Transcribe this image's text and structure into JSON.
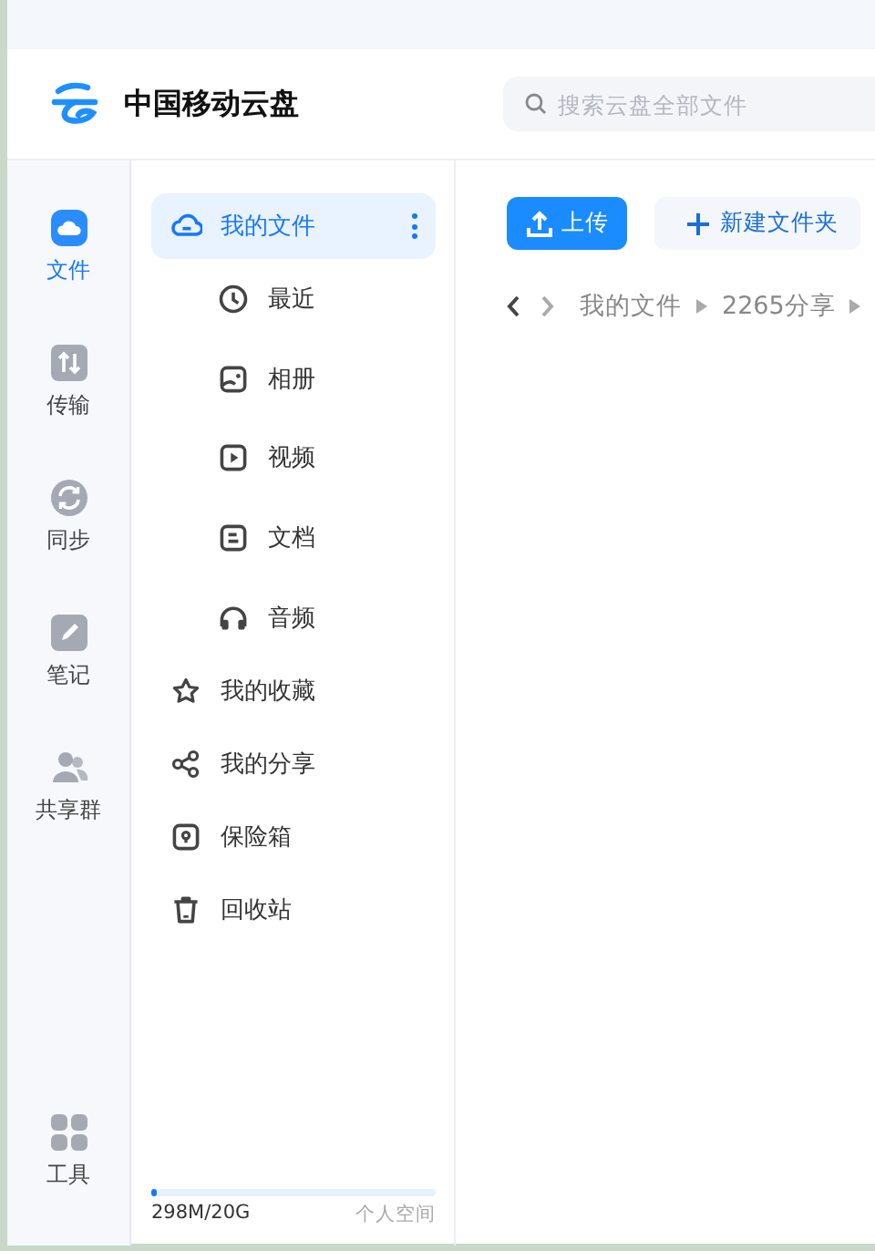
{
  "app": {
    "title": "中国移动云盘"
  },
  "search": {
    "placeholder": "搜索云盘全部文件"
  },
  "rail": [
    {
      "kind": "files",
      "label": "文件",
      "selected": true
    },
    {
      "kind": "transfer",
      "label": "传输",
      "selected": false
    },
    {
      "kind": "sync",
      "label": "同步",
      "selected": false
    },
    {
      "kind": "notes",
      "label": "笔记",
      "selected": false
    },
    {
      "kind": "group",
      "label": "共享群",
      "selected": false
    }
  ],
  "rail_bottom": {
    "kind": "tools",
    "label": "工具"
  },
  "tree": [
    {
      "kind": "cloud",
      "label": "我的文件",
      "selected": true,
      "children": [
        {
          "kind": "clock",
          "label": "最近",
          "selected": false
        },
        {
          "kind": "photo",
          "label": "相册",
          "selected": false
        },
        {
          "kind": "video",
          "label": "视频",
          "selected": false
        },
        {
          "kind": "doc",
          "label": "文档",
          "selected": false
        },
        {
          "kind": "audio",
          "label": "音频",
          "selected": false
        }
      ]
    },
    {
      "kind": "star",
      "label": "我的收藏",
      "selected": false
    },
    {
      "kind": "share",
      "label": "我的分享",
      "selected": false
    },
    {
      "kind": "safe",
      "label": "保险箱",
      "selected": false
    },
    {
      "kind": "trash",
      "label": "回收站",
      "selected": false
    }
  ],
  "storage": {
    "level": 0.015,
    "usage": "298M/20G",
    "label": "个人空间"
  },
  "toolbar": [
    {
      "kind": "upload",
      "label": "上传"
    },
    {
      "kind": "new-folder",
      "label": "新建文件夹"
    }
  ],
  "breadcrumb": [
    "我的文件",
    "2265分享"
  ]
}
